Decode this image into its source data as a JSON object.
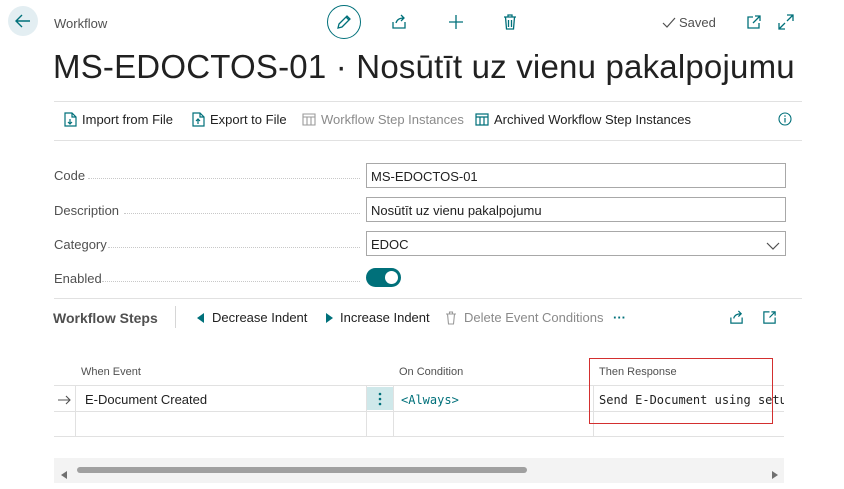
{
  "header": {
    "breadcrumb": "Workflow",
    "saved_label": "Saved",
    "title": "MS-EDOCTOS-01 · Nosūtīt uz vienu pakalpojumu"
  },
  "actions": {
    "import": "Import from File",
    "export": "Export to File",
    "step_instances": "Workflow Step Instances",
    "archived": "Archived Workflow Step Instances"
  },
  "fields": {
    "code": {
      "label": "Code",
      "value": "MS-EDOCTOS-01"
    },
    "description": {
      "label": "Description",
      "value": "Nosūtīt uz vienu pakalpojumu"
    },
    "category": {
      "label": "Category",
      "value": "EDOC"
    },
    "enabled": {
      "label": "Enabled",
      "value": true
    }
  },
  "steps": {
    "title": "Workflow Steps",
    "decrease_indent": "Decrease Indent",
    "increase_indent": "Increase Indent",
    "delete_conditions": "Delete Event Conditions",
    "more": "···",
    "columns": {
      "when_event": "When Event",
      "on_condition": "On Condition",
      "then_response": "Then Response"
    },
    "rows": [
      {
        "when_event": "E-Document Created",
        "on_condition": "<Always>",
        "then_response": "Send E-Document using setup: UNASSIGNED"
      }
    ]
  },
  "colors": {
    "accent": "#00707a",
    "highlight_border": "#d32f2f",
    "selected_cell": "#cfe8ea"
  }
}
